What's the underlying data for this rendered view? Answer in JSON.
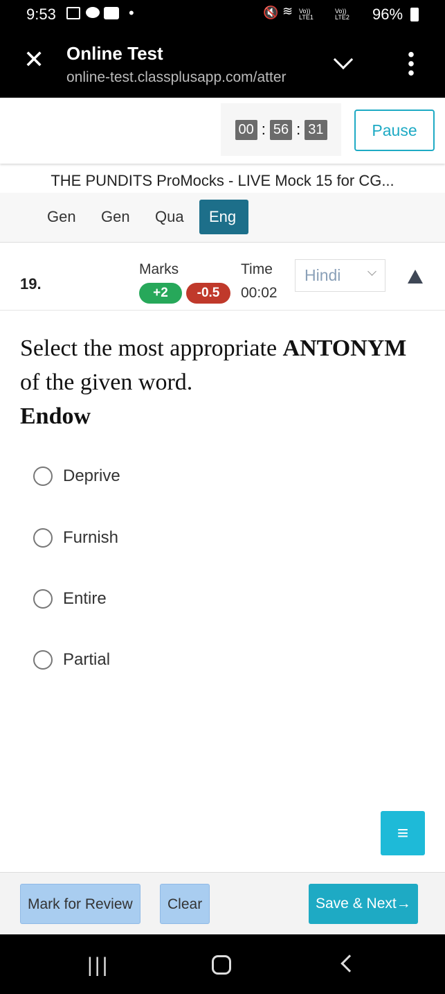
{
  "status_bar": {
    "time": "9:53",
    "battery": "96%",
    "icons": [
      "gallery-icon",
      "chat-icon",
      "youtube-icon",
      "dot-icon",
      "mute-icon",
      "wifi-icon",
      "signal-lte1-icon",
      "signal-lte2-icon",
      "battery-icon"
    ],
    "lte1": "Vo)) LTE1",
    "lte2": "Vo)) LTE2"
  },
  "browser": {
    "title": "Online Test",
    "url": "online-test.classplusapp.com/atter"
  },
  "timer": {
    "hours": "00",
    "minutes": "56",
    "seconds": "31",
    "separator": ":",
    "pause_label": "Pause"
  },
  "test_title": "THE PUNDITS ProMocks - LIVE Mock 15 for CG...",
  "sections": [
    {
      "label": "Gen"
    },
    {
      "label": "Gen"
    },
    {
      "label": "Qua"
    },
    {
      "label": "Eng",
      "active": true
    }
  ],
  "question": {
    "number": "19.",
    "marks_label": "Marks",
    "positive": "+2",
    "negative": "-0.5",
    "time_label": "Time",
    "time": "00:02",
    "language": "Hindi",
    "text_1": "Select the most appropriate ",
    "text_bold": "ANTONYM",
    "text_2": " of the given word.",
    "word": "Endow",
    "options": [
      "Deprive",
      "Furnish",
      "Entire",
      "Partial"
    ]
  },
  "footer": {
    "mark_review": "Mark for Review",
    "clear": "Clear",
    "save_next": "Save & Next→"
  },
  "colors": {
    "accent": "#1d6f8a",
    "positive": "#27a85a",
    "negative": "#c0392b",
    "save": "#1eaac4",
    "review": "#a9cdf0"
  }
}
